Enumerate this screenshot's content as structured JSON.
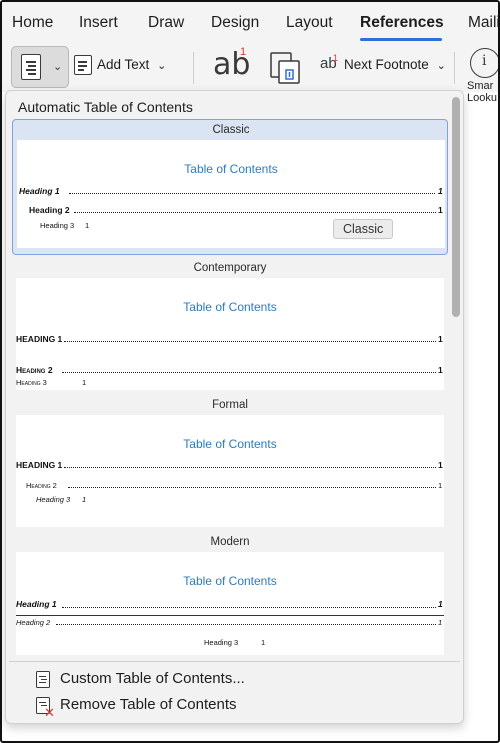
{
  "ribbon": {
    "tabs": [
      "Home",
      "Insert",
      "Draw",
      "Design",
      "Layout",
      "References",
      "Maili"
    ],
    "active_tab": "References",
    "accent_color": "#2f6fd6",
    "toolbar": {
      "add_text_label": "Add Text",
      "insert_footnote_glyph": "ab",
      "insert_footnote_sup": "1",
      "next_footnote_glyph": "ab",
      "next_footnote_sup": "1",
      "next_footnote_label": "Next Footnote",
      "smart_lookup_label_line1": "Smar",
      "smart_lookup_label_line2": "Looku"
    }
  },
  "dropdown": {
    "section_title": "Automatic Table of Contents",
    "templates": [
      {
        "name": "Classic",
        "toc_title": "Table of Contents",
        "entries": [
          {
            "text": "Heading 1",
            "page": "1"
          },
          {
            "text": "Heading 2",
            "page": "1"
          },
          {
            "text": "Heading 3",
            "page": "1"
          }
        ]
      },
      {
        "name": "Contemporary",
        "toc_title": "Table of Contents",
        "entries": [
          {
            "text": "HEADING 1",
            "page": "1"
          },
          {
            "text": "Heading 2",
            "page": "1"
          },
          {
            "text": "Heading 3",
            "page": "1"
          }
        ]
      },
      {
        "name": "Formal",
        "toc_title": "Table of Contents",
        "entries": [
          {
            "text": "HEADING 1",
            "page": "1"
          },
          {
            "text": "Heading 2",
            "page": "1"
          },
          {
            "text": "Heading 3",
            "page": "1"
          }
        ]
      },
      {
        "name": "Modern",
        "toc_title": "Table of Contents",
        "entries": [
          {
            "text": "Heading 1",
            "page": "1"
          },
          {
            "text": "Heading 2",
            "page": "1"
          },
          {
            "text": "Heading 3",
            "page": "1"
          }
        ]
      }
    ],
    "tooltip": "Classic",
    "menu": {
      "custom_label": "Custom Table of Contents...",
      "remove_label": "Remove Table of Contents"
    },
    "toc_title_color": "#2c7bbf",
    "selection_color": "#7fa3d8"
  }
}
